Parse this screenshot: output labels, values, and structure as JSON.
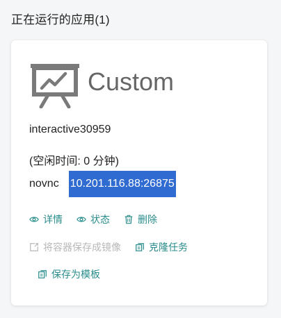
{
  "section_title": "正在运行的应用(1)",
  "card": {
    "app_name": "Custom",
    "instance_name": "interactive30959",
    "idle_time": "(空闲时间: 0 分钟)",
    "novnc_label": "novnc",
    "novnc_address": "10.201.116.88:26875"
  },
  "actions": {
    "details": "详情",
    "status": "状态",
    "delete": "删除",
    "save_image": "将容器保存成镜像",
    "clone_task": "克隆任务",
    "save_template": "保存为模板"
  },
  "colors": {
    "accent": "#2a8c8c",
    "disabled": "#b8b8b8",
    "selection": "#2f6bd1"
  }
}
